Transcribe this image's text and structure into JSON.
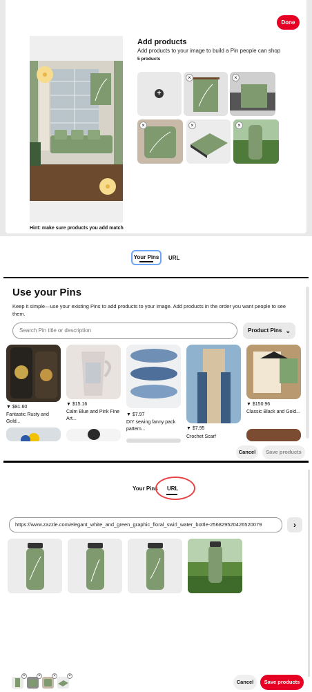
{
  "panel1": {
    "done_label": "Done",
    "title": "Add products",
    "subtitle": "Add products to your image to build a Pin people can shop",
    "count": "5 products",
    "hint": "Hint: make sure products you add match",
    "add_tile_icon": "plus-icon",
    "product_tiles": [
      {
        "name": "wall-hanging-scroll"
      },
      {
        "name": "throw-blanket-on-sofa"
      },
      {
        "name": "throw-pillow"
      },
      {
        "name": "laptop-sleeve"
      },
      {
        "name": "water-bottle-landscape"
      }
    ]
  },
  "panel2": {
    "tabs": {
      "your_pins": "Your Pins",
      "url": "URL"
    },
    "heading": "Use your Pins",
    "description": "Keep it simple—use your existing Pins to add products to your image. Add products in the order you want people to see them.",
    "search_placeholder": "Search Pin title or description",
    "filter_label": "Product Pins",
    "pins": [
      {
        "price": "$81.60",
        "title": "Fantastic Rusty and Gold..."
      },
      {
        "price": "$15.16",
        "title": "Calm Blue and Pink Fine Art..."
      },
      {
        "price": "$7.97",
        "title": "DIY sewing fanny pack pattern..."
      },
      {
        "price": "$7.95",
        "title": "Crochet Scarf"
      },
      {
        "price": "$150.96",
        "title": "Classic Black and Gold..."
      }
    ],
    "cancel_label": "Cancel",
    "save_label": "Save products"
  },
  "panel3": {
    "tabs": {
      "your_pins": "Your Pins",
      "url": "URL"
    },
    "url_value": "https://www.zazzle.com/elegant_white_and_green_graphic_floral_swirl_water_bottle-256829520426520079",
    "cancel_label": "Cancel",
    "save_label": "Save products"
  },
  "colors": {
    "accent_red": "#e60023",
    "sage_green": "#7f9a6e",
    "focus_blue": "#6aa6f4"
  }
}
